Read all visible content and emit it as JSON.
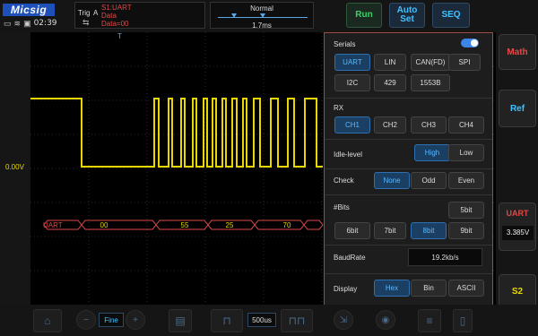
{
  "header": {
    "logo": "Micsig",
    "clock": "02:39",
    "trigger": {
      "label": "Trig",
      "source": "A",
      "line1": "S1:UART",
      "line2": "Data",
      "line3": "Data=00"
    },
    "timebase": {
      "mode": "Normal",
      "value": "1.7ms"
    },
    "buttons": {
      "run": "Run",
      "auto_set": "Auto Set",
      "seq": "SEQ"
    }
  },
  "sidebar": {
    "math": "Math",
    "ref": "Ref",
    "uart_title": "UART",
    "uart_value": "3.385V",
    "s2": "S2"
  },
  "screen": {
    "ch1_offset": "0.00V",
    "ch1_marker": "1",
    "uart_name": "UART",
    "trigger_position_marker": "T",
    "decode_values": [
      "00",
      "55",
      "25",
      "70"
    ]
  },
  "panel": {
    "serials": {
      "label": "Serials",
      "enabled": true,
      "options": [
        "UART",
        "LIN",
        "CAN(FD)",
        "SPI",
        "I2C",
        "429",
        "1553B"
      ],
      "selected": "UART"
    },
    "rx": {
      "label": "RX",
      "options": [
        "CH1",
        "CH2",
        "CH3",
        "CH4"
      ],
      "selected": "CH1"
    },
    "idle_level": {
      "label": "Idle-level",
      "options": [
        "High",
        "Low"
      ],
      "selected": "High"
    },
    "check": {
      "label": "Check",
      "options": [
        "None",
        "Odd",
        "Even"
      ],
      "selected": "None"
    },
    "bits": {
      "label": "#Bits",
      "options": [
        "5bit",
        "6bit",
        "7bit",
        "8bit",
        "9bit"
      ],
      "selected": "8bit"
    },
    "baud": {
      "label": "BaudRate",
      "value": "19.2kb/s"
    },
    "display": {
      "label": "Display",
      "options": [
        "Hex",
        "Bin",
        "ASCII"
      ],
      "selected": "Hex"
    }
  },
  "bottombar": {
    "fine_label": "Fine",
    "timebase_value": "500us"
  },
  "colors": {
    "ch1": "#e8d800",
    "uart": "#e04a4a",
    "accent": "#41c2ff",
    "run": "#3cd06a"
  }
}
